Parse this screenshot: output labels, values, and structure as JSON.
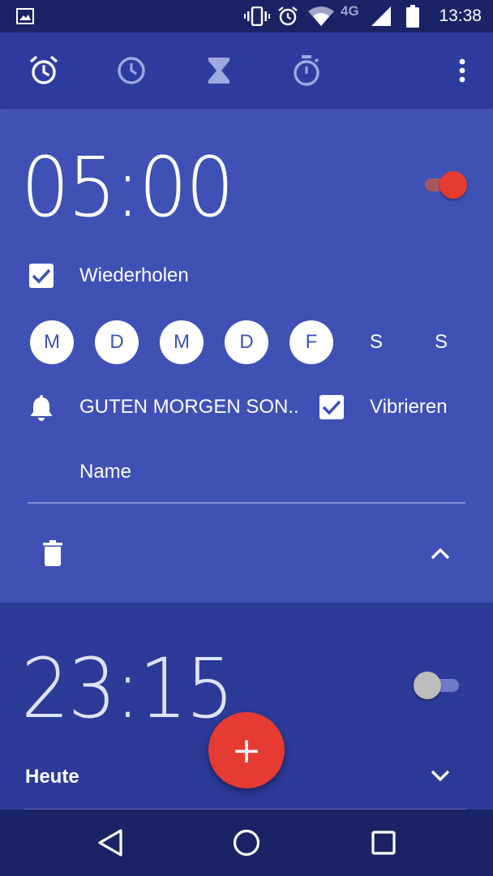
{
  "status_bar": {
    "time": "13:38",
    "network": "4G",
    "icons": [
      "image-icon",
      "vibrate-icon",
      "alarm-icon",
      "wifi-icon",
      "signal-icon",
      "battery-icon"
    ]
  },
  "tabs": [
    {
      "name": "alarm",
      "icon": "alarm-clock-icon",
      "active": true
    },
    {
      "name": "clock",
      "icon": "clock-icon",
      "active": false
    },
    {
      "name": "timer",
      "icon": "hourglass-icon",
      "active": false
    },
    {
      "name": "stopwatch",
      "icon": "stopwatch-icon",
      "active": false
    }
  ],
  "alarms": [
    {
      "time": "05:00",
      "enabled": true,
      "repeat_label": "Wiederholen",
      "repeat_checked": true,
      "days": [
        {
          "label": "M",
          "on": true
        },
        {
          "label": "D",
          "on": true
        },
        {
          "label": "M",
          "on": true
        },
        {
          "label": "D",
          "on": true
        },
        {
          "label": "F",
          "on": true
        },
        {
          "label": "S",
          "on": false
        },
        {
          "label": "S",
          "on": false
        }
      ],
      "ringtone": "GUTEN MORGEN SON..",
      "vibrate_label": "Vibrieren",
      "vibrate_checked": true,
      "name_placeholder": "Name"
    },
    {
      "time": "23:15",
      "enabled": false,
      "subtitle": "Heute"
    }
  ],
  "fab": {
    "label": "+"
  },
  "colors": {
    "primary": "#3f51b5",
    "primary_dark": "#2c3a98",
    "status_bar": "#1a2366",
    "accent": "#e53b33",
    "toggle_off_thumb": "#bdbdbd",
    "toggle_off_track": "#6f7bc8"
  }
}
